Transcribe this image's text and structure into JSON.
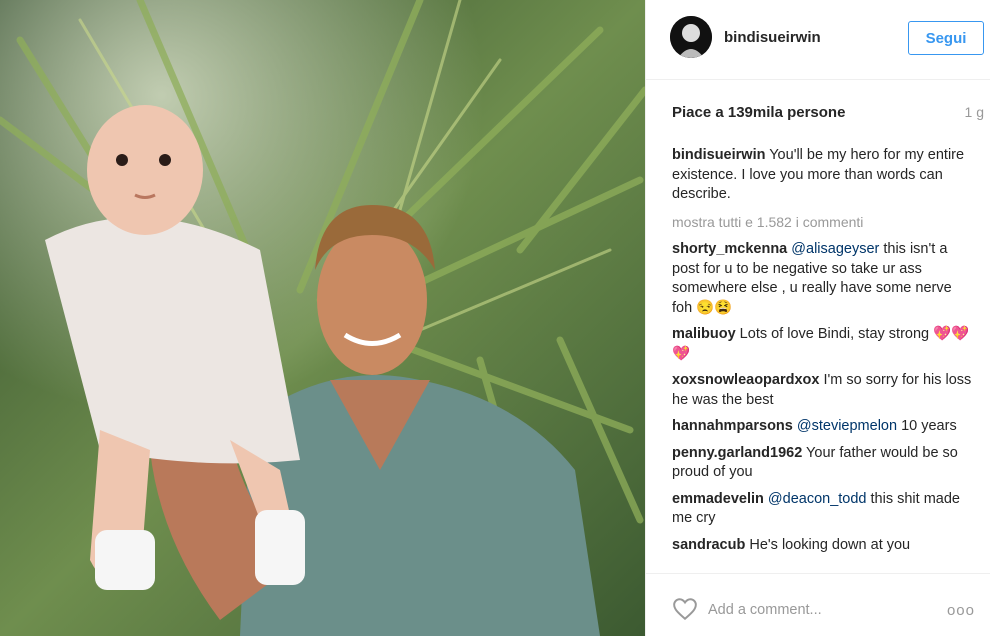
{
  "header": {
    "username": "bindisueirwin",
    "follow_label": "Segui"
  },
  "stats": {
    "likes": "Piace a 139mila persone",
    "age": "1 g"
  },
  "caption": {
    "user": "bindisueirwin",
    "text": " You'll be my hero for my entire existence. I love you more than words can describe."
  },
  "show_all": "mostra tutti e 1.582 i commenti",
  "comments": [
    {
      "user": "shorty_mckenna",
      "mention": "@alisageyser",
      "text": " this isn't a post for u to be negative so take ur ass somewhere else , u really have some nerve foh 😒😫"
    },
    {
      "user": "malibuoy",
      "mention": "",
      "text": " Lots of love Bindi, stay strong 💖💖💖"
    },
    {
      "user": "xoxsnowleaopardxox",
      "mention": "",
      "text": " I'm so sorry for his loss he was the best"
    },
    {
      "user": "hannahmparsons",
      "mention": "@steviepmelon",
      "text": " 10 years"
    },
    {
      "user": "penny.garland1962",
      "mention": "",
      "text": " Your father would be so proud of you"
    },
    {
      "user": "emmadevelin",
      "mention": "@deacon_todd",
      "text": " this shit made me cry"
    },
    {
      "user": "sandracub",
      "mention": "",
      "text": " He's looking down at you"
    }
  ],
  "footer": {
    "placeholder": "Add a comment...",
    "more_label": "ooo"
  },
  "colors": {
    "accent": "#3897f0",
    "text": "#262626",
    "muted": "#999999",
    "mention": "#003569"
  },
  "icons": {
    "like": "heart-outline-icon",
    "more": "more-options-icon"
  }
}
